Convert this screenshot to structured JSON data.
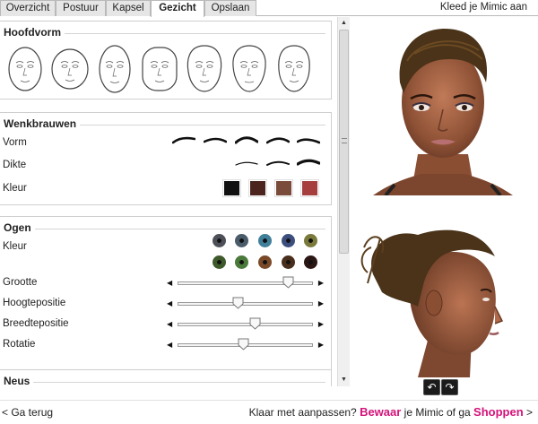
{
  "tabs": [
    {
      "label": "Overzicht",
      "active": false
    },
    {
      "label": "Postuur",
      "active": false
    },
    {
      "label": "Kapsel",
      "active": false
    },
    {
      "label": "Gezicht",
      "active": true
    },
    {
      "label": "Opslaan",
      "active": false
    }
  ],
  "header": {
    "title": "Kleed je Mimic aan"
  },
  "sections": {
    "face_shape": {
      "title": "Hoofdvorm",
      "shapes": [
        "face-shape-1",
        "face-shape-2",
        "face-shape-3",
        "face-shape-4",
        "face-shape-5",
        "face-shape-6",
        "face-shape-7"
      ]
    },
    "eyebrows": {
      "title": "Wenkbrauwen",
      "rows": {
        "shape": "Vorm",
        "thickness": "Dikte",
        "color": "Kleur"
      },
      "colors": [
        "#111111",
        "#4a241d",
        "#7a4a3a",
        "#a63e3e"
      ]
    },
    "eyes": {
      "title": "Ogen",
      "color_label": "Kleur",
      "colors_row1": [
        "#4d5058",
        "#4a5c6a",
        "#3f7f9a",
        "#3b4e7e",
        "#7a7a3c"
      ],
      "colors_row2": [
        "#3f5a2a",
        "#4a7a3a",
        "#7a4a28",
        "#4a2e1c",
        "#2a1612"
      ],
      "sliders": [
        {
          "label": "Grootte",
          "value": 0.82
        },
        {
          "label": "Hoogtepositie",
          "value": 0.45
        },
        {
          "label": "Breedtepositie",
          "value": 0.57
        },
        {
          "label": "Rotatie",
          "value": 0.49
        }
      ]
    },
    "nose": {
      "title": "Neus"
    }
  },
  "footer": {
    "back": "< Ga terug",
    "prompt": "Klaar met aanpassen?",
    "save": "Bewaar",
    "middle": "je Mimic of ga",
    "shop": "Shoppen",
    "arrow": ">"
  },
  "icons": {
    "rotate_left": "rotate-left-icon",
    "rotate_right": "rotate-right-icon"
  }
}
